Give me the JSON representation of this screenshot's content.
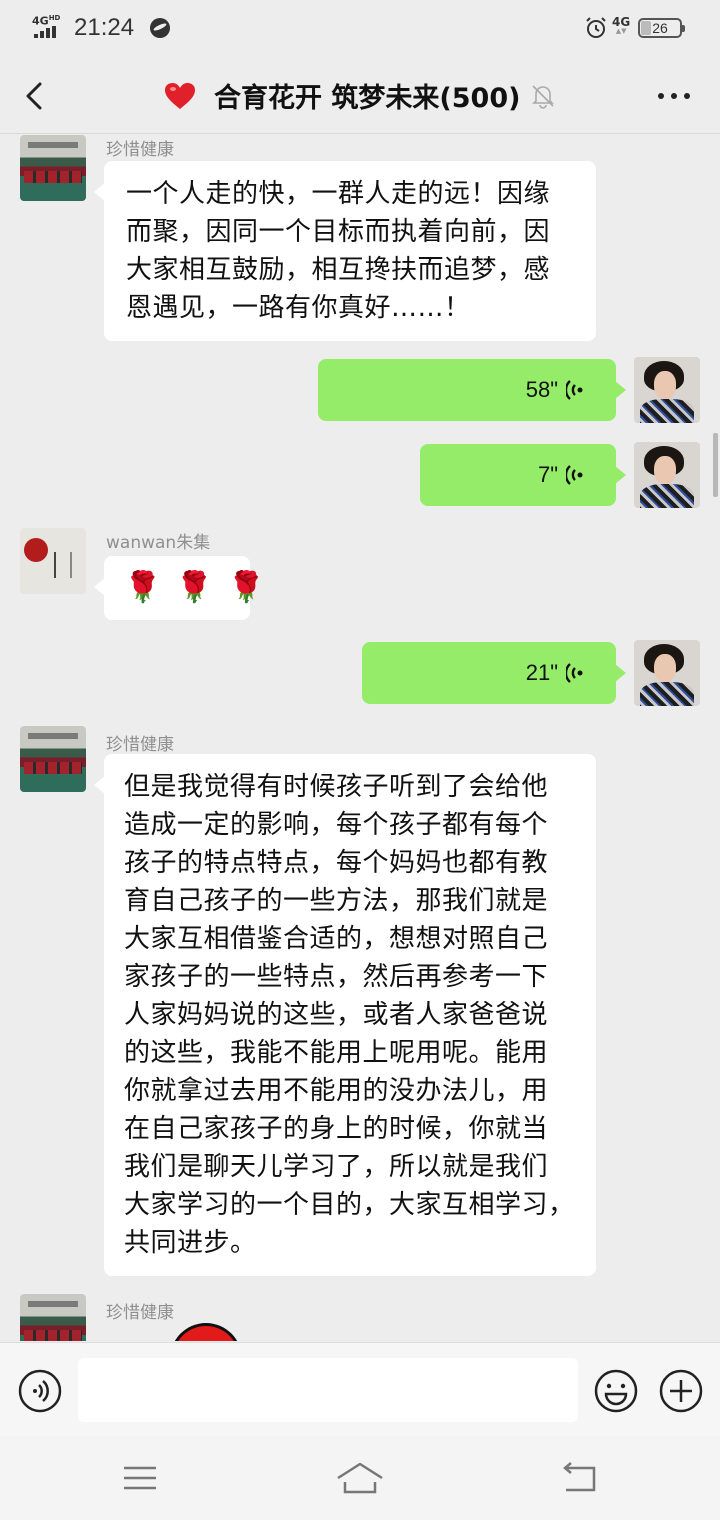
{
  "status_bar": {
    "network": "4G",
    "network_sup": "HD",
    "time": "21:24",
    "mobile": "4G",
    "battery": "26"
  },
  "header": {
    "title": "合育花开 筑梦未来(500)",
    "icons": [
      "back-arrow-icon",
      "heart-icon",
      "bell-mute-icon",
      "more-dots-icon"
    ]
  },
  "messages": [
    {
      "type": "text",
      "side": "left",
      "sender": "珍惜健康",
      "avatar": "factory-avatar",
      "lines": [
        "一个人走的快，一群人走的远！因缘",
        "而聚，因同一个目标而执着向前，因",
        "大家相互鼓励，相互搀扶而追梦，感",
        "恩遇见，一路有你真好……！"
      ]
    },
    {
      "type": "voice",
      "side": "right",
      "duration": "58\"",
      "avatar": "woman-avatar"
    },
    {
      "type": "voice",
      "side": "right",
      "duration": "7\"",
      "avatar": "woman-avatar"
    },
    {
      "type": "emoji",
      "side": "left",
      "sender": "wanwan朱集",
      "avatar": "paper-avatar",
      "emojis": [
        "🌹",
        "🌹",
        "🌹"
      ]
    },
    {
      "type": "voice",
      "side": "right",
      "duration": "21\"",
      "avatar": "woman-avatar"
    },
    {
      "type": "text",
      "side": "left",
      "sender": "珍惜健康",
      "avatar": "factory-avatar",
      "lines": [
        "但是我觉得有时候孩子听到了会给他",
        "造成一定的影响，每个孩子都有每个",
        "孩子的特点特点，每个妈妈也都有教",
        "育自己孩子的一些方法，那我们就是",
        "大家互相借鉴合适的，想想对照自己",
        "家孩子的一些特点，然后再参考一下",
        "人家妈妈说的这些，或者人家爸爸说",
        "的这些，我能不能用上呢用呢。能用",
        "你就拿过去用不能用的没办法儿，用",
        "在自己家孩子的身上的时候，你就当",
        "我们是聊天儿学习了，所以就是我们",
        "大家学习的一个目的，大家互相学习，",
        "共同进步。"
      ]
    },
    {
      "type": "sticker",
      "side": "left",
      "sender": "珍惜健康",
      "avatar": "factory-avatar"
    }
  ],
  "input_bar": {
    "value": "",
    "icons": [
      "voice-input-icon",
      "emoji-icon",
      "plus-icon"
    ]
  },
  "nav_bar": {
    "icons": [
      "menu-icon",
      "home-icon",
      "back-icon"
    ]
  },
  "colors": {
    "background": "#ededed",
    "bubble_self": "#95ec69",
    "bubble_other": "#ffffff",
    "sender_name": "#8f8f8f"
  }
}
